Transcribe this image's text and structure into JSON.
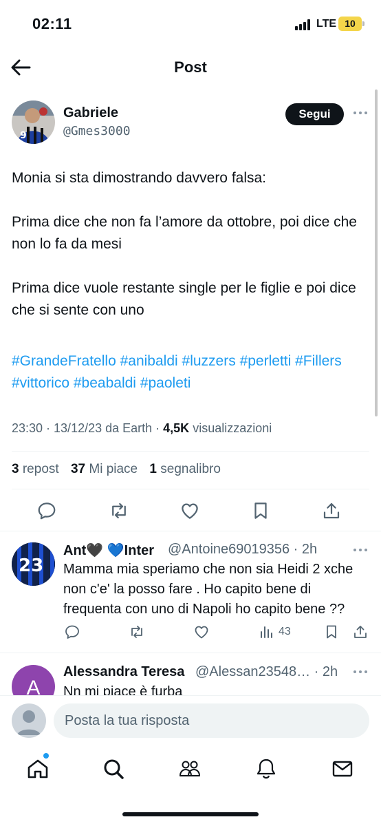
{
  "status_bar": {
    "time": "02:11",
    "network": "LTE",
    "battery": "10"
  },
  "header": {
    "title": "Post"
  },
  "post": {
    "author_name": "Gabriele",
    "author_handle": "@Gmes3000",
    "follow_label": "Segui",
    "text": "Monia si sta dimostrando davvero falsa:\n\nPrima dice che non fa l’amore da ottobre, poi dice che non lo fa da mesi\n\nPrima dice vuole restante single per le figlie e poi dice che si sente con uno",
    "hashtags": [
      "#GrandeFratello",
      "#anibaldi",
      "#luzzers",
      "#perletti",
      "#Fillers",
      "#vittorico",
      "#beabaldi",
      "#paoleti"
    ],
    "timestamp": "23:30 · 13/12/23 da Earth · ",
    "views_count": "4,5K",
    "views_label": " visualizzazioni",
    "reposts_count": "3",
    "reposts_label": "repost",
    "likes_count": "37",
    "likes_label": "Mi piace",
    "bookmarks_count": "1",
    "bookmarks_label": "segnalibro"
  },
  "replies": [
    {
      "name": "Ant🖤 💙Inter",
      "handle": "@Antoine69019356 · 2h",
      "text": "Mamma mia speriamo che non sia Heidi 2 xche non c'e' la posso fare . Ho capito bene di frequenta con uno di Napoli ho capito bene ??",
      "views": "43",
      "avatar_text": "23"
    },
    {
      "name": "Alessandra Teresa",
      "handle": "@Alessan23548… · 2h",
      "text": "Nn mi piace è furba",
      "avatar_letter": "A"
    }
  ],
  "composer": {
    "placeholder": "Posta la tua risposta"
  },
  "colors": {
    "accent": "#1d9bf0",
    "text": "#0f1419",
    "secondary": "#536471",
    "avatar_purple": "#8e44ad"
  },
  "tabs": [
    "home-icon",
    "search-icon",
    "communities-icon",
    "notifications-icon",
    "messages-icon"
  ]
}
